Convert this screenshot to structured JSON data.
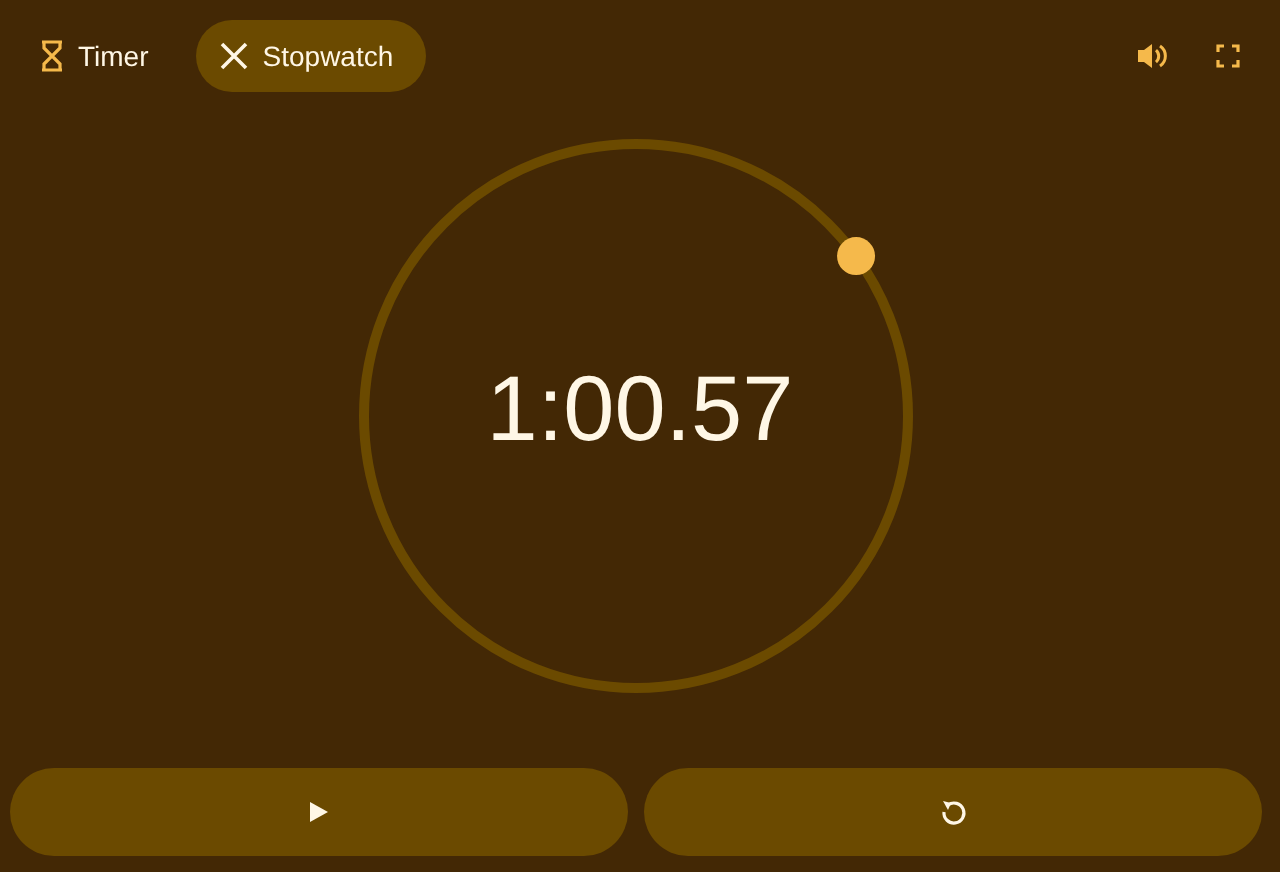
{
  "tabs": [
    {
      "label": "Timer",
      "selected": false
    },
    {
      "label": "Stopwatch",
      "selected": true
    }
  ],
  "dial": {
    "time": "1:00.57"
  }
}
